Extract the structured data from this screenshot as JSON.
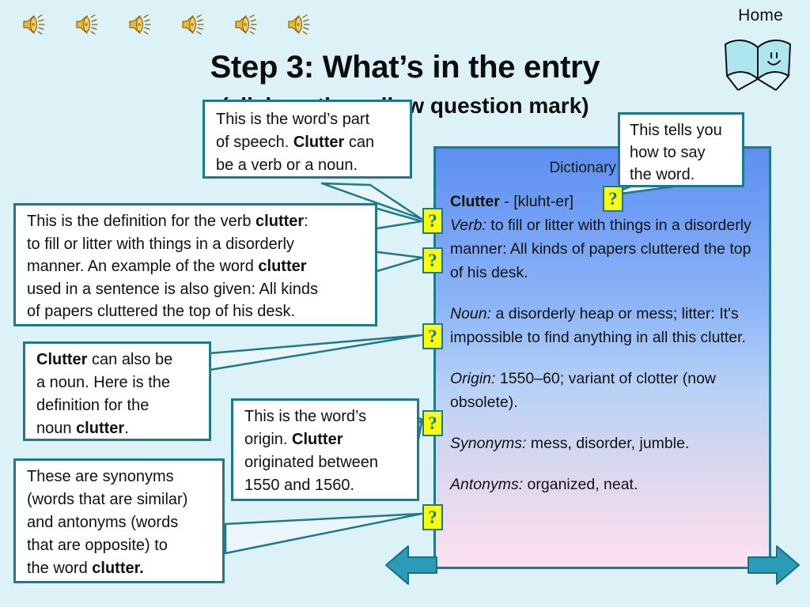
{
  "slide": {
    "background_color": "#ddf2f7",
    "accent_color": "#1d7a8c",
    "title": "Step 3: What’s in the entry",
    "subtitle": "(click on the yellow question mark)"
  },
  "header": {
    "home_label": "Home",
    "book_icon": "open-book-icon",
    "speaker_icon": "speaker-sound-icon",
    "speaker_count": 6
  },
  "panel": {
    "title": "Dictionary Entry",
    "headword": "Clutter",
    "dash": " - ",
    "pronunciation": "[kluht-er]",
    "verb_label": "Verb:",
    "verb_definition": " to fill or litter with things in a disorderly manner: All kinds of papers cluttered the top of his desk.",
    "noun_label": "Noun:",
    "noun_definition": " a disorderly heap or mess; litter: It's impossible to find anything in all this clutter.",
    "origin_label": "Origin:",
    "origin_text": " 1550–60; variant of clotter  (now obsolete).",
    "synonyms_label": "Synonyms:",
    "synonyms_text": " mess, disorder, jumble.",
    "antonyms_label": "Antonyms:",
    "antonyms_text": " organized, neat."
  },
  "question_marks": {
    "glyph": "?",
    "count": 6,
    "fill_color": "#ffff00",
    "border_color": "#1d7a8c",
    "glyph_color": "#137a87"
  },
  "callouts": {
    "part_of_speech": {
      "line1": "This is the word’s part",
      "line2_pre": "of speech. ",
      "line2_bold": "Clutter",
      "line2_post": " can",
      "line3": "be a verb or a noun."
    },
    "pronunciation": {
      "line1": "This tells you",
      "line2": "how to say",
      "line3": "the word."
    },
    "verb_definition": {
      "line1_pre": "This is the definition for the verb ",
      "line1_bold": "clutter",
      "line1_post": ":",
      "line2": "to fill or litter with things in a disorderly",
      "line3_pre": "manner. An example of the word ",
      "line3_bold": "clutter",
      "line4": "used in a sentence is also given: All kinds",
      "line5": "of papers cluttered the top of his desk."
    },
    "noun_definition": {
      "line1_bold": "Clutter",
      "line1_post": " can also be",
      "line2": "a noun. Here is the",
      "line3": "definition for the",
      "line4_pre": "noun ",
      "line4_bold": "clutter",
      "line4_post": "."
    },
    "origin": {
      "line1": "This is the word’s",
      "line2_pre": "origin. ",
      "line2_bold": "Clutter",
      "line3": "originated between",
      "line4": "1550 and 1560."
    },
    "synonyms_antonyms": {
      "line1": "These are synonyms",
      "line2": "(words that are similar)",
      "line3": "and antonyms (words",
      "line4": "that are opposite) to",
      "line5_pre": "the word ",
      "line5_bold": "clutter."
    }
  },
  "navigation": {
    "previous_icon": "arrow-left-icon",
    "next_icon": "arrow-right-icon",
    "arrow_color": "#2a9cb8"
  }
}
